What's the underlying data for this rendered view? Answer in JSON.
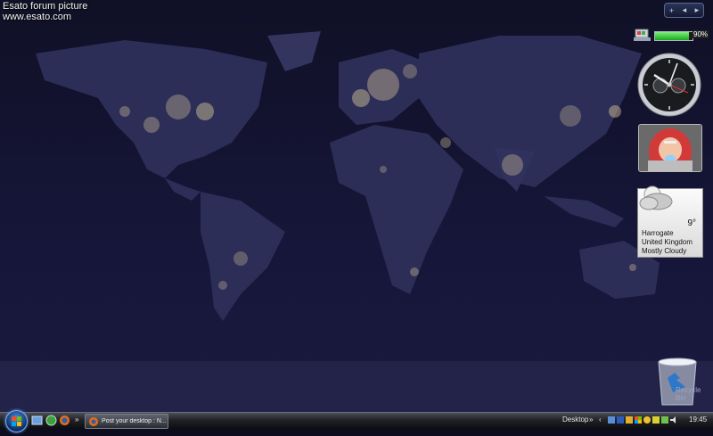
{
  "watermark": {
    "line1": "Esato forum picture",
    "line2": "www.esato.com"
  },
  "sidebar": {
    "controls": {
      "add": "+",
      "prev": "◂",
      "next": "▸"
    },
    "battery": {
      "level": 90,
      "label": "90%"
    },
    "clock": {
      "time": "19:45"
    },
    "weather": {
      "temperature": "9°",
      "city": "Harrogate",
      "country": "United Kingdom",
      "condition": "Mostly Cloudy"
    }
  },
  "desktop": {
    "recycle_bin_label": "Recycle Bin"
  },
  "taskbar": {
    "quick_launch_more": "»",
    "task_button_label": "Post your desktop : N...",
    "desktop_toolbar_label": "Desktop",
    "toolbar_more": "»",
    "tray_arrow": "‹",
    "clock": "19:45"
  },
  "colors": {
    "night": "#0c0c1e",
    "land": "#2d2e58",
    "lights": "#ffe9a8",
    "battery": "#2ec22e"
  }
}
